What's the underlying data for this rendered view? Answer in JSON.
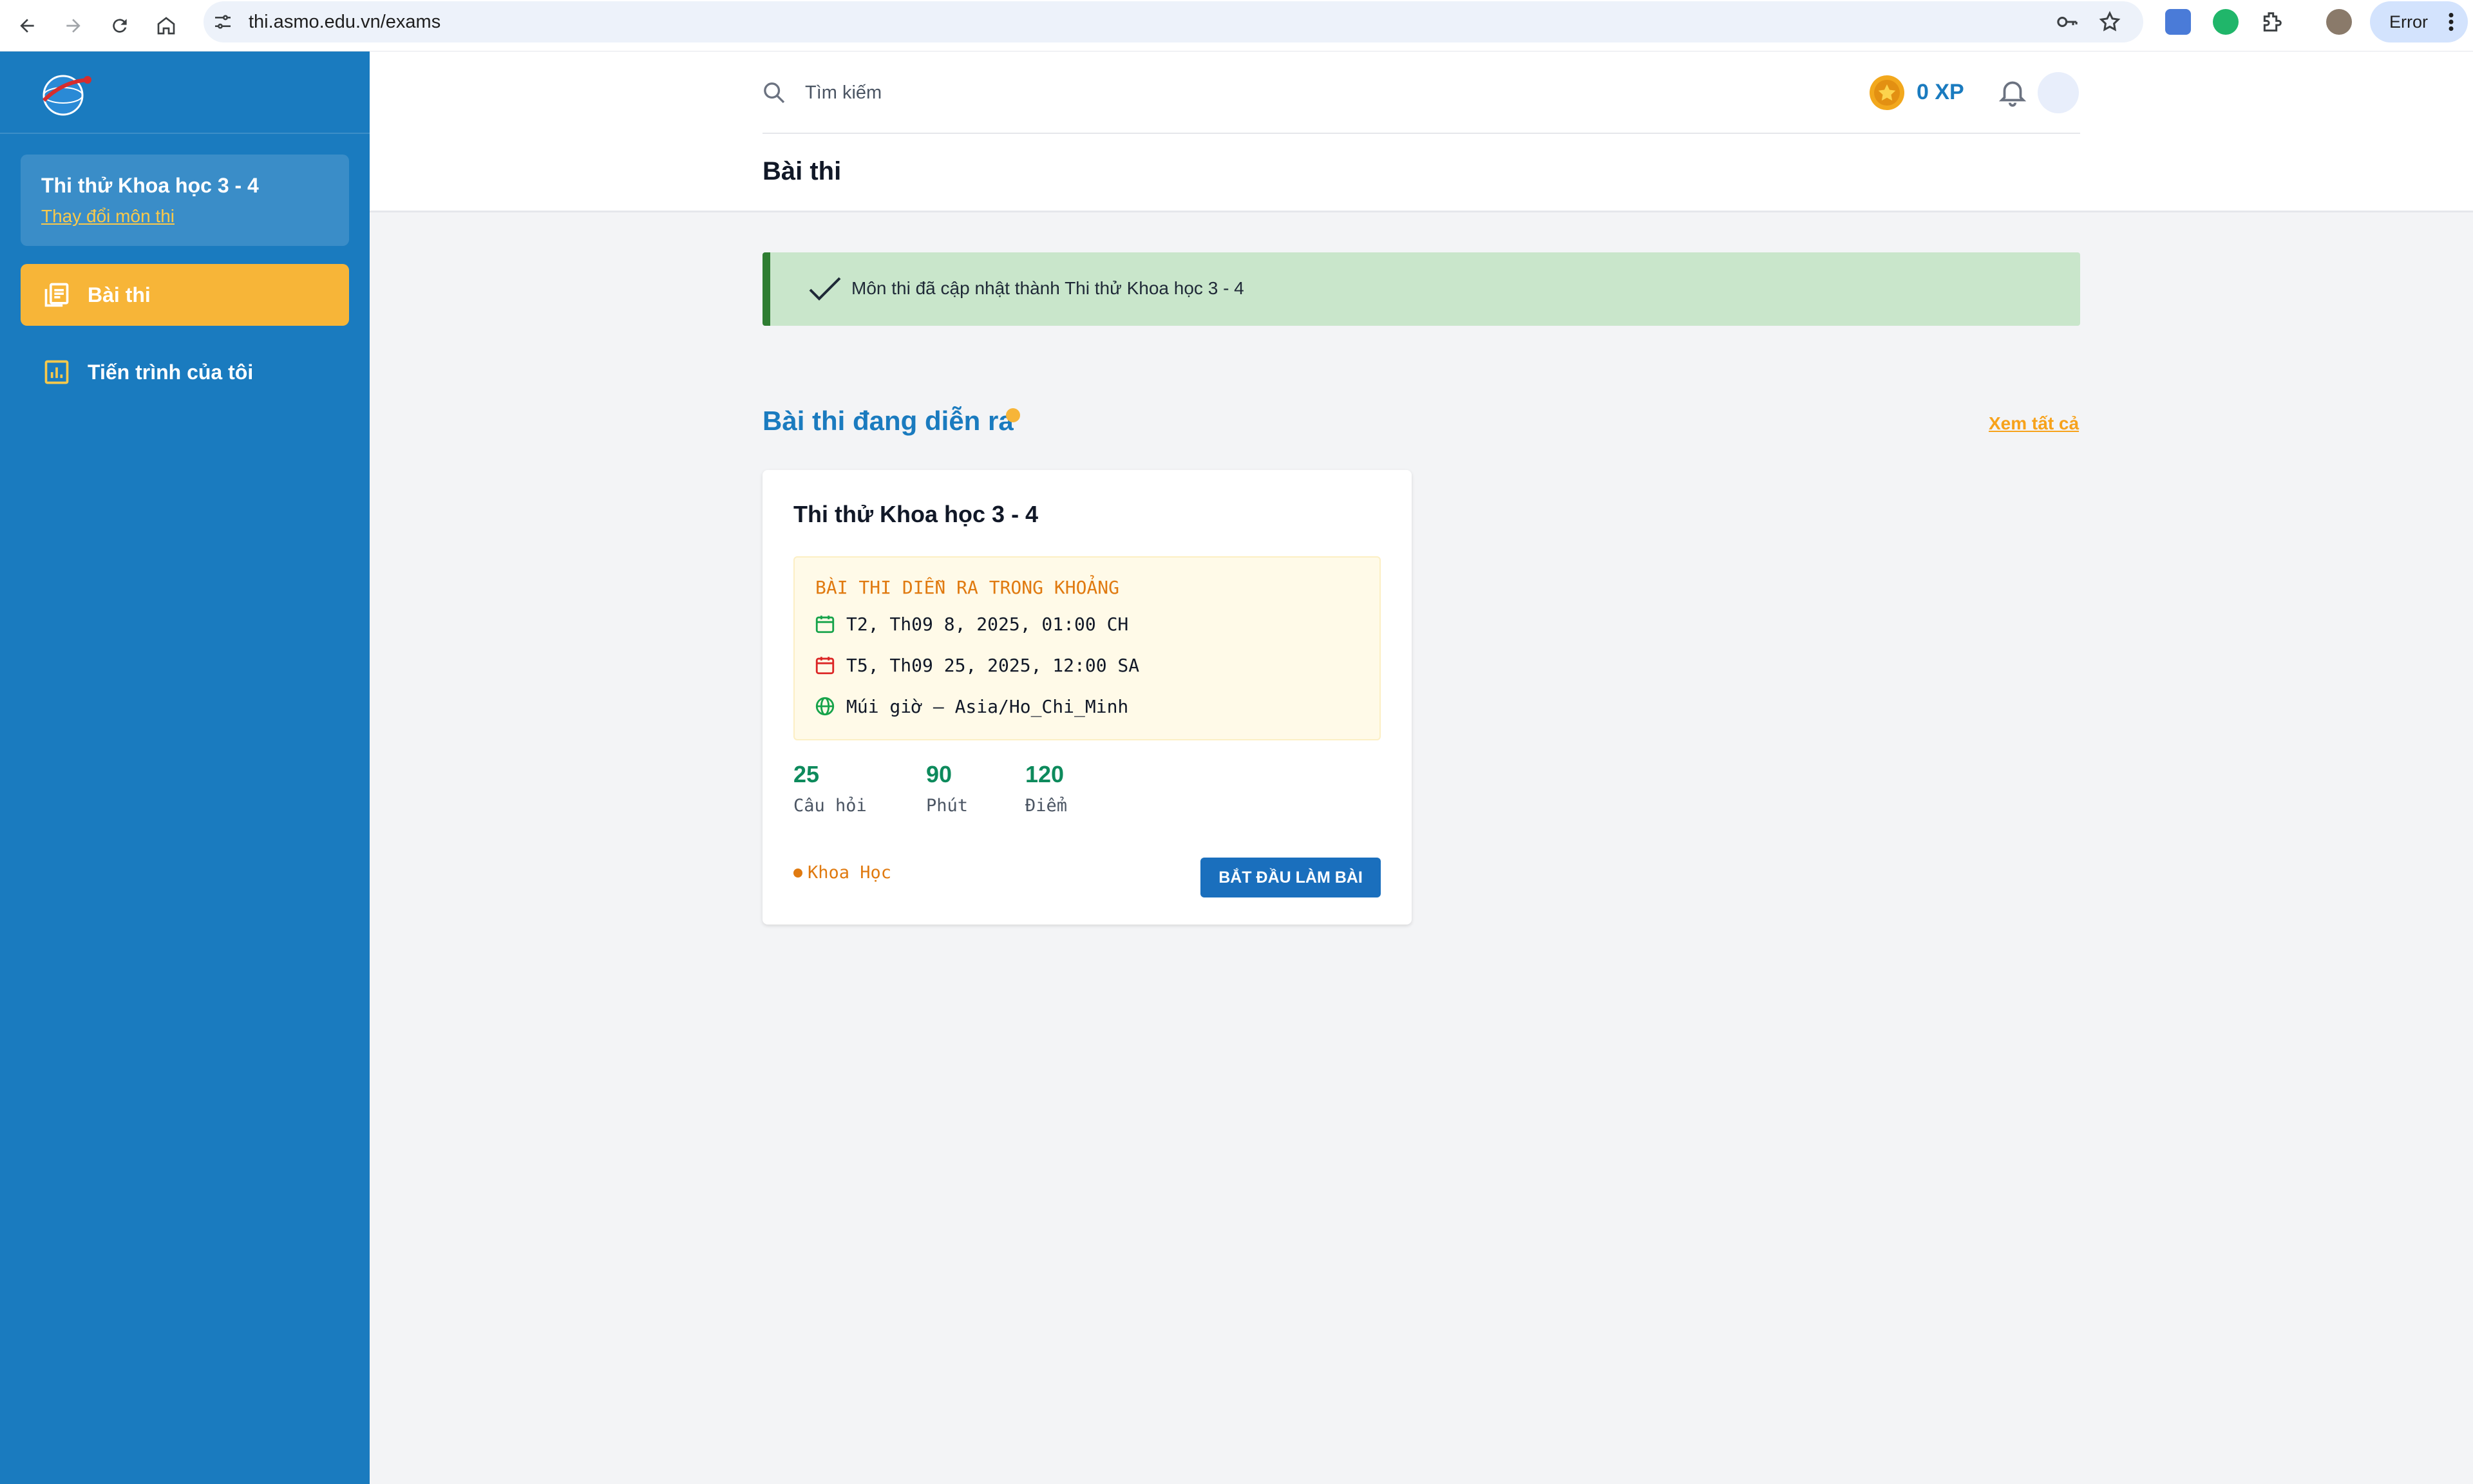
{
  "browser": {
    "url": "thi.asmo.edu.vn/exams",
    "profile_label": "Error"
  },
  "sidebar": {
    "subject_title": "Thi thử Khoa học 3 - 4",
    "change_subject": "Thay đổi môn thi",
    "items": [
      {
        "label": "Bài thi",
        "active": true
      },
      {
        "label": "Tiến trình của tôi",
        "active": false
      }
    ]
  },
  "header": {
    "search_placeholder": "Tìm kiếm",
    "xp": "0 XP",
    "page_title": "Bài thi"
  },
  "alert": {
    "message": "Môn thi đã cập nhật thành Thi thử Khoa học 3 - 4"
  },
  "section": {
    "title": "Bài thi đang diễn ra",
    "see_all": "Xem tất cả"
  },
  "exam": {
    "title": "Thi thử Khoa học 3 - 4",
    "schedule_heading": "BÀI THI DIỄN RA TRONG KHOẢNG",
    "start": "T2, Th09 8, 2025, 01:00 CH",
    "end": "T5, Th09 25, 2025, 12:00 SA",
    "timezone": "Múi giờ – Asia/Ho_Chi_Minh",
    "stats": [
      {
        "value": "25",
        "label": "Câu hỏi"
      },
      {
        "value": "90",
        "label": "Phút"
      },
      {
        "value": "120",
        "label": "Điểm"
      }
    ],
    "subject_tag": "Khoa Học",
    "start_button": "BẮT ĐẦU LÀM BÀI"
  },
  "colors": {
    "sidebar_bg": "#1a7bbf",
    "active_item": "#f7b538",
    "alert_bg": "#c9e6cb",
    "stat_green": "#0d8a5c",
    "accent_orange": "#e07a10",
    "button_blue": "#1a6fbd"
  }
}
